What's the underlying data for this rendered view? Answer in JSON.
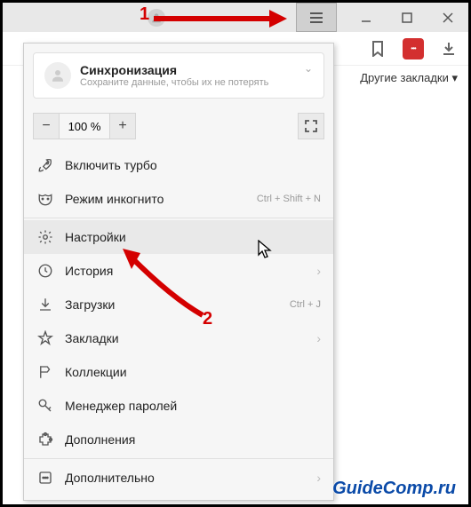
{
  "annotations": {
    "one": "1",
    "two": "2"
  },
  "sync": {
    "title": "Синхронизация",
    "subtitle": "Сохраните данные, чтобы их не потерять"
  },
  "zoom": {
    "minus": "−",
    "value": "100 %",
    "plus": "+"
  },
  "menu": {
    "turbo": "Включить турбо",
    "incognito": "Режим инкогнито",
    "incognito_shortcut": "Ctrl + Shift + N",
    "settings": "Настройки",
    "history": "История",
    "downloads": "Загрузки",
    "downloads_shortcut": "Ctrl + J",
    "bookmarks": "Закладки",
    "collections": "Коллекции",
    "passwords": "Менеджер паролей",
    "addons": "Дополнения",
    "advanced": "Дополнительно"
  },
  "bookmarks_bar": "Другие закладки ▾",
  "watermark": "GuideComp.ru"
}
